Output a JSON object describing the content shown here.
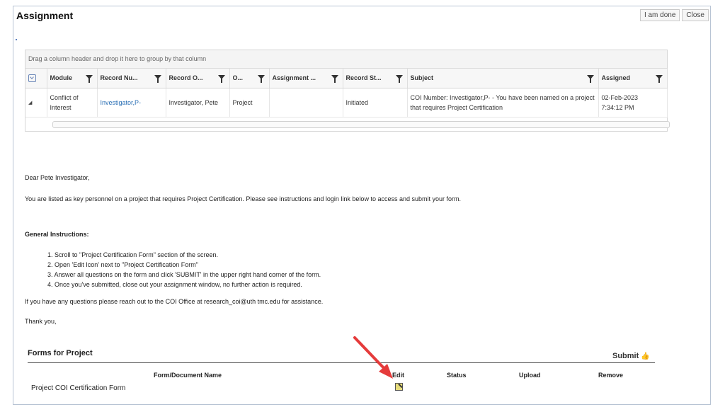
{
  "window": {
    "title": "Assignment",
    "buttons": {
      "done": "I am done",
      "close": "Close"
    }
  },
  "grid": {
    "group_hint": "Drag a column header and drop it here to group by that column",
    "columns": [
      "Module",
      "Record Nu...",
      "Record O...",
      "O...",
      "Assignment ...",
      "Record St...",
      "Subject",
      "Assigned"
    ],
    "row": {
      "module": "Conflict of Interest",
      "record_number": "Investigator,P-",
      "record_owner": "Investigator, Pete",
      "o": "Project",
      "assignment": "",
      "record_status": "Initiated",
      "subject": "COI Number: Investigator,P- - You have been named on a project that requires Project Certification",
      "assigned_date": "02-Feb-2023",
      "assigned_time": "7:34:12 PM"
    }
  },
  "message": {
    "greeting": "Dear Pete Investigator,",
    "intro": "You are listed as key personnel on a project that requires Project Certification. Please see instructions and login link below to access and submit your form.",
    "instructions_title": "General Instructions:",
    "instructions": [
      "1. Scroll to \"Project Certification Form\" section of the screen.",
      "2. Open 'Edit Icon' next to \"Project Certification Form\"",
      "3. Answer all questions on the form and click 'SUBMIT' in the upper right hand corner of the form.",
      "4. Once you've submitted, close out your assignment window, no further action is required."
    ],
    "contact": "If you have any questions please reach out to the COI Office at research_coi@uth tmc.edu for assistance.",
    "closing": "Thank you,"
  },
  "forms": {
    "title": "Forms for Project",
    "submit_label": "Submit",
    "columns": {
      "name": "Form/Document Name",
      "edit": "Edit",
      "status": "Status",
      "upload": "Upload",
      "remove": "Remove"
    },
    "rows": [
      {
        "name": "Project COI Certification Form",
        "edit_icon": "edit-icon"
      }
    ]
  },
  "colors": {
    "link": "#2a6fb5",
    "annotation_arrow": "#e53b3b"
  }
}
